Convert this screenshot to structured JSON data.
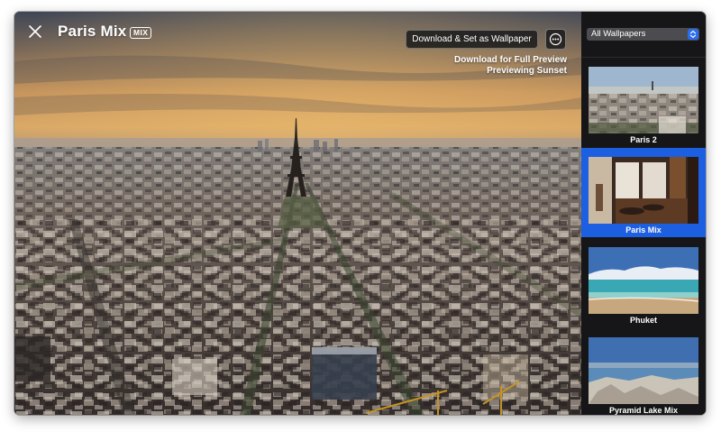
{
  "header": {
    "title": "Paris Mix",
    "badge": "MIX",
    "close_icon": "close-icon"
  },
  "toolbar": {
    "download_label": "Download & Set as Wallpaper",
    "more_icon": "ellipsis-icon"
  },
  "preview_info": {
    "line1": "Download for Full Preview",
    "line2": "Previewing Sunset"
  },
  "sidebar": {
    "filter": "All Wallpapers",
    "items": [
      {
        "label": "Paris 2",
        "selected": false
      },
      {
        "label": "Paris Mix",
        "selected": true
      },
      {
        "label": "Phuket",
        "selected": false
      },
      {
        "label": "Pyramid Lake Mix",
        "selected": false
      }
    ]
  },
  "colors": {
    "selection": "#1c5fe0",
    "sidebar_bg": "#161618",
    "select_accent": "#2b6df0"
  }
}
